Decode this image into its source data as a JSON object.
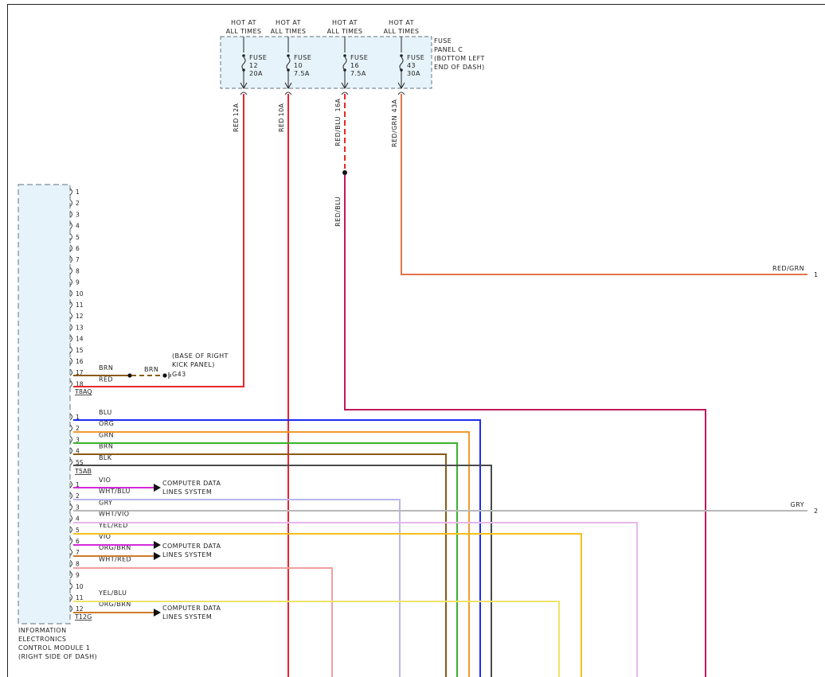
{
  "fuse_panel": {
    "labels": [
      "FUSE",
      "PANEL C",
      "(BOTTOM LEFT",
      "END OF DASH)"
    ],
    "fuses": [
      {
        "hot": [
          "HOT AT",
          "ALL TIMES"
        ],
        "label": "FUSE",
        "num": "12",
        "amp": "20A",
        "circuit": "12A",
        "wire": "RED",
        "color": "#e8262a"
      },
      {
        "hot": [
          "HOT AT",
          "ALL TIMES"
        ],
        "label": "FUSE",
        "num": "10",
        "amp": "7.5A",
        "circuit": "10A",
        "wire": "RED",
        "color": "#e8262a"
      },
      {
        "hot": [
          "HOT AT",
          "ALL TIMES"
        ],
        "label": "FUSE",
        "num": "16",
        "amp": "7.5A",
        "circuit": "16A",
        "wire": "RED/BLU",
        "color": "#e8262a"
      },
      {
        "hot": [
          "HOT AT",
          "ALL TIMES"
        ],
        "label": "FUSE",
        "num": "43",
        "amp": "30A",
        "circuit": "43A",
        "wire": "RED/GRN",
        "color": "#e3744a"
      }
    ]
  },
  "splice_wire": "RED/BLU",
  "module": {
    "name": [
      "INFORMATION",
      "ELECTRONICS",
      "CONTROL MODULE 1",
      "(RIGHT SIDE OF DASH)"
    ]
  },
  "connectors": {
    "t8aq": {
      "id": "T8AQ",
      "pins": [
        "1",
        "2",
        "3",
        "4",
        "5",
        "6",
        "7",
        "8",
        "9",
        "10",
        "11",
        "12",
        "13",
        "14",
        "15",
        "16",
        "17",
        "18"
      ],
      "wires": [
        {
          "pin": "17",
          "color_name": "BRN",
          "color": "#8a5a10"
        },
        {
          "pin": "18",
          "color_name": "RED",
          "color": "#e8262a"
        }
      ]
    },
    "t5ab": {
      "id": "T5AB",
      "wires": [
        {
          "pin": "1",
          "color_name": "BLU",
          "color": "#1c2bf0"
        },
        {
          "pin": "2",
          "color_name": "ORG",
          "color": "#f39a2e"
        },
        {
          "pin": "3",
          "color_name": "GRN",
          "color": "#39b22e"
        },
        {
          "pin": "4",
          "color_name": "BRN",
          "color": "#8a5a10"
        },
        {
          "pin": "5S",
          "color_name": "BLK",
          "color": "#4a4a4a"
        }
      ]
    },
    "t12g": {
      "id": "T12G",
      "wires": [
        {
          "pin": "1",
          "color_name": "VIO",
          "color": "#d42ad8"
        },
        {
          "pin": "2",
          "color_name": "WHT/BLU",
          "color": "#b9b7ec"
        },
        {
          "pin": "3",
          "color_name": "GRY",
          "color": "#b8b8b8"
        },
        {
          "pin": "4",
          "color_name": "WHT/VIO",
          "color": "#e8b6ec"
        },
        {
          "pin": "5",
          "color_name": "YEL/RED",
          "color": "#f5c01a"
        },
        {
          "pin": "6",
          "color_name": "VIO",
          "color": "#d42ad8"
        },
        {
          "pin": "7",
          "color_name": "ORG/BRN",
          "color": "#cf7a2a"
        },
        {
          "pin": "8",
          "color_name": "WHT/RED",
          "color": "#f0a0a0"
        },
        {
          "pin": "9",
          "color_name": "",
          "color": "#f0a0a0"
        },
        {
          "pin": "10",
          "color_name": "",
          "color": ""
        },
        {
          "pin": "11",
          "color_name": "YEL/BLU",
          "color": "#efe26a"
        },
        {
          "pin": "12",
          "color_name": "ORG/BRN",
          "color": "#cf7a2a"
        }
      ]
    }
  },
  "ground": {
    "wire": "BRN",
    "id": "G43",
    "location": [
      "(BASE OF RIGHT",
      "KICK PANEL)"
    ]
  },
  "data_lines": [
    "COMPUTER DATA",
    "LINES SYSTEM"
  ],
  "exits": [
    {
      "wire": "RED/GRN",
      "ref": "1"
    },
    {
      "wire": "GRY",
      "ref": "2"
    }
  ]
}
